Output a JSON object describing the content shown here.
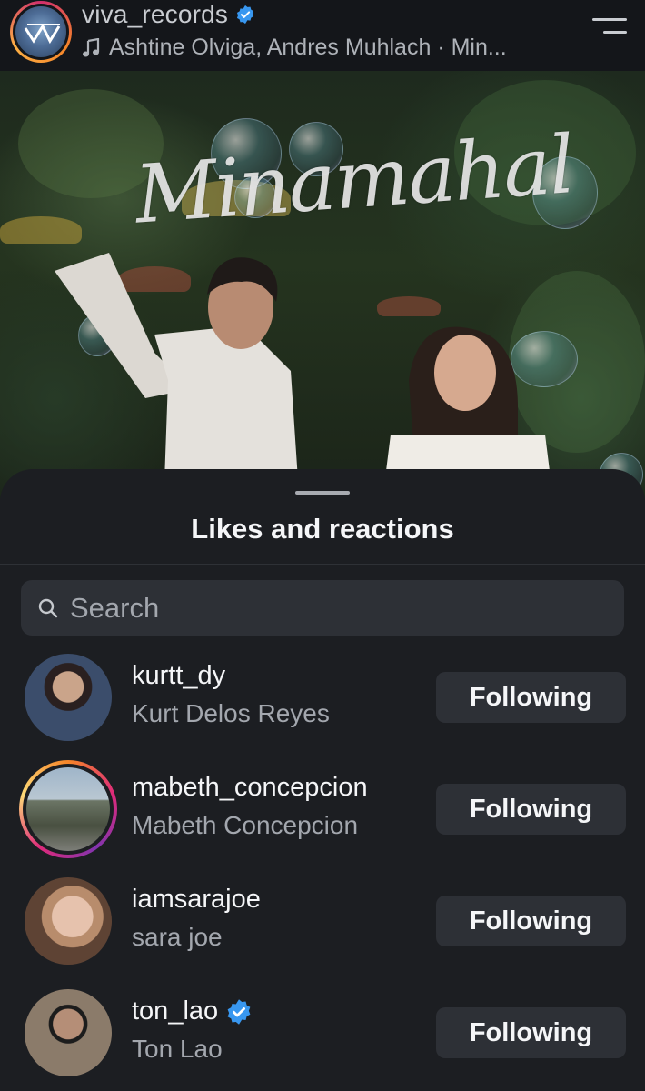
{
  "header": {
    "account_name": "viva_records",
    "music_line": "Ashtine Olviga, Andres Muhlach · Min...",
    "verified_color": "#3897f0"
  },
  "photo": {
    "title_art_text": "Minamahal"
  },
  "sheet": {
    "title": "Likes and reactions",
    "search_placeholder": "Search"
  },
  "users": [
    {
      "username": "kurtt_dy",
      "fullname": "Kurt Delos Reyes",
      "verified": false,
      "story_ring": false,
      "button_label": "Following"
    },
    {
      "username": "mabeth_concepcion",
      "fullname": "Mabeth Concepcion",
      "verified": false,
      "story_ring": true,
      "button_label": "Following"
    },
    {
      "username": "iamsarajoe",
      "fullname": "sara joe",
      "verified": false,
      "story_ring": false,
      "button_label": "Following"
    },
    {
      "username": "ton_lao",
      "fullname": "Ton Lao",
      "verified": true,
      "story_ring": false,
      "button_label": "Following"
    }
  ],
  "icons": {
    "menu": "hamburger-menu-icon",
    "music": "music-note-icon",
    "search": "search-icon",
    "verified": "verified-badge-icon"
  }
}
